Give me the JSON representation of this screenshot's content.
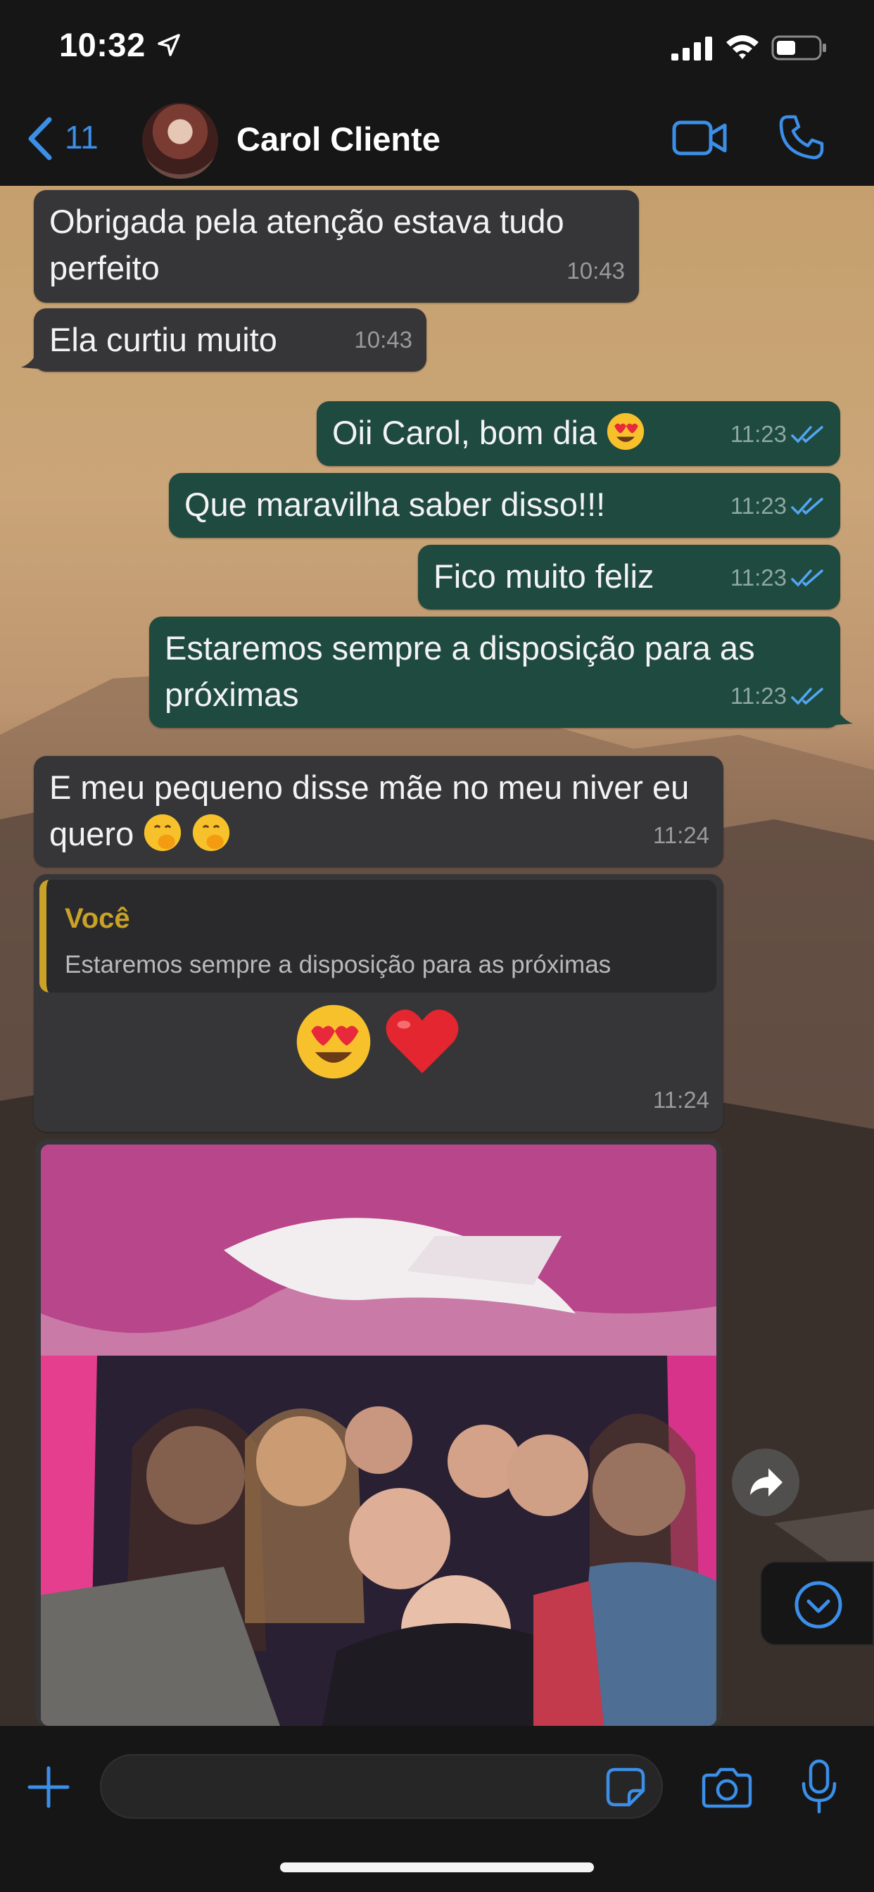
{
  "status_bar": {
    "time": "10:32"
  },
  "header": {
    "back_count": "11",
    "contact_name": "Carol Cliente"
  },
  "messages": [
    {
      "text": "Obrigada pela atenção estava tudo perfeito",
      "time": "10:43",
      "direction": "incoming"
    },
    {
      "text": "Ela curtiu muito",
      "time": "10:43",
      "direction": "incoming"
    },
    {
      "text": "Oii Carol, bom dia",
      "emoji": "heart-eyes-emoji",
      "time": "11:23",
      "direction": "outgoing",
      "read": true
    },
    {
      "text": "Que maravilha saber disso!!!",
      "time": "11:23",
      "direction": "outgoing",
      "read": true
    },
    {
      "text": "Fico muito feliz",
      "time": "11:23",
      "direction": "outgoing",
      "read": true
    },
    {
      "text": "Estaremos sempre a disposição para as próximas",
      "time": "11:23",
      "direction": "outgoing",
      "read": true
    },
    {
      "text": "E meu pequeno disse mãe no meu niver eu quero",
      "emoji": "hand-over-mouth-emoji",
      "time": "11:24",
      "direction": "incoming"
    },
    {
      "reply_to": {
        "author": "Você",
        "text": "Estaremos sempre a disposição para as próximas"
      },
      "emoji": [
        "heart-eyes-emoji",
        "red-heart-emoji"
      ],
      "time": "11:24",
      "direction": "incoming"
    },
    {
      "type": "photo",
      "direction": "incoming"
    }
  ],
  "input": {
    "placeholder": ""
  },
  "colors": {
    "accent": "#3b8fe8",
    "incoming_bubble": "#363638",
    "outgoing_bubble": "#1f4a3f",
    "reply_author": "#c9a227",
    "bar_background": "#161616"
  }
}
